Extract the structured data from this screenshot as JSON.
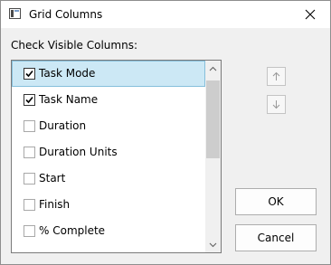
{
  "window": {
    "title": "Grid Columns",
    "app_icon": "grid-window-icon",
    "close_icon": "close-icon"
  },
  "caption": "Check Visible Columns:",
  "columns": [
    {
      "label": "Task Mode",
      "checked": true,
      "selected": true
    },
    {
      "label": "Task Name",
      "checked": true,
      "selected": false
    },
    {
      "label": "Duration",
      "checked": false,
      "selected": false
    },
    {
      "label": "Duration Units",
      "checked": false,
      "selected": false
    },
    {
      "label": "Start",
      "checked": false,
      "selected": false
    },
    {
      "label": "Finish",
      "checked": false,
      "selected": false
    },
    {
      "label": "% Complete",
      "checked": false,
      "selected": false
    }
  ],
  "side_buttons": {
    "move_up_icon": "arrow-up-icon",
    "move_down_icon": "arrow-down-icon"
  },
  "buttons": {
    "ok_label": "OK",
    "cancel_label": "Cancel"
  },
  "colors": {
    "selection_bg": "#cce8f5",
    "selection_border": "#86bfdb"
  }
}
